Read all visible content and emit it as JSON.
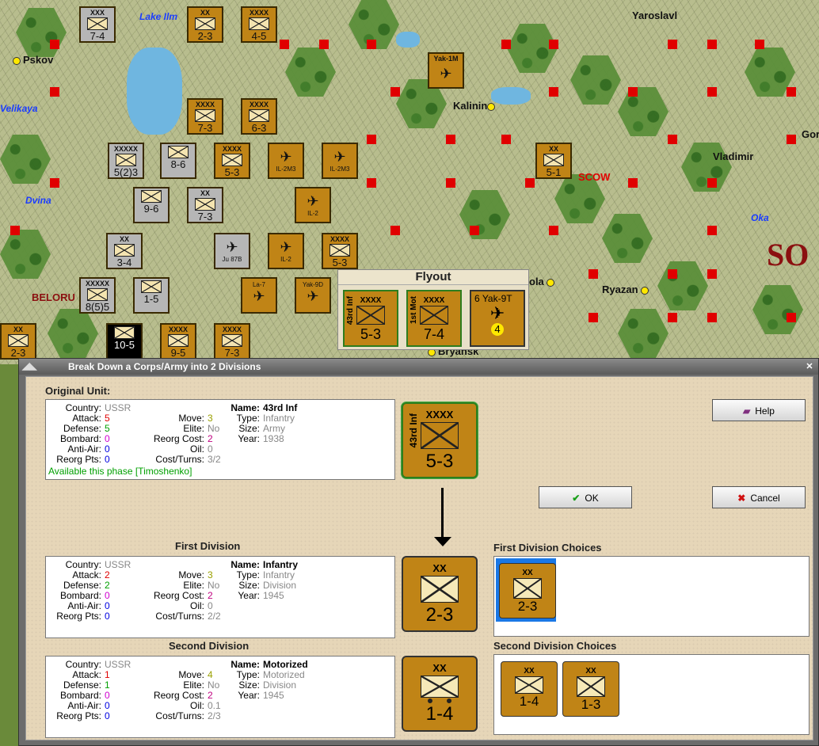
{
  "map": {
    "cities": [
      "Pskov",
      "Kalinin",
      "Yaroslavl",
      "Vladimir",
      "Ryazan",
      "Bryansk",
      "Gor",
      "SCOW",
      "ola"
    ],
    "rivers": [
      "Lake Ilm",
      "Velikaya",
      "Dvina",
      "Oka"
    ],
    "region_big": "SO",
    "region_small": "BELORU",
    "stacks": [
      {
        "size": "XXX",
        "vals": "7-4",
        "kind": "g"
      },
      {
        "size": "XX",
        "vals": "2-3",
        "kind": "o"
      },
      {
        "size": "XXXX",
        "vals": "4-5",
        "kind": "o"
      },
      {
        "size": "",
        "vals": "Yak-1M",
        "kind": "o"
      },
      {
        "size": "XXXX",
        "vals": "7-3",
        "kind": "o"
      },
      {
        "size": "XXXX",
        "vals": "6-3",
        "kind": "o"
      },
      {
        "size": "XXXXX",
        "vals": "5(2)3",
        "kind": "g"
      },
      {
        "size": "",
        "vals": "8-6",
        "kind": "g"
      },
      {
        "size": "XXXX",
        "vals": "5-3",
        "kind": "o"
      },
      {
        "size": "",
        "vals": "IL-2M3",
        "kind": "o"
      },
      {
        "size": "",
        "vals": "IL-2M3",
        "kind": "o"
      },
      {
        "size": "XX",
        "vals": "5-1",
        "kind": "o"
      },
      {
        "size": "",
        "vals": "9-6",
        "kind": "g"
      },
      {
        "size": "XX",
        "vals": "7-3",
        "kind": "g"
      },
      {
        "size": "",
        "vals": "IL-2",
        "kind": "o"
      },
      {
        "size": "XX",
        "vals": "3-4",
        "kind": "g"
      },
      {
        "size": "",
        "vals": "Ju 87B",
        "kind": "g"
      },
      {
        "size": "",
        "vals": "IL-2",
        "kind": "o"
      },
      {
        "size": "XXXX",
        "vals": "5-3",
        "kind": "o"
      },
      {
        "size": "XXXXX",
        "vals": "8(5)5",
        "kind": "g"
      },
      {
        "size": "",
        "vals": "1-5",
        "kind": "g"
      },
      {
        "size": "",
        "vals": "La-7",
        "kind": "o"
      },
      {
        "size": "",
        "vals": "Yak-9D",
        "kind": "o"
      },
      {
        "size": "XX",
        "vals": "2-3",
        "kind": "o"
      },
      {
        "size": "",
        "vals": "10-5",
        "kind": "b"
      },
      {
        "size": "XXXX",
        "vals": "9-5",
        "kind": "o"
      },
      {
        "size": "XXXX",
        "vals": "7-3",
        "kind": "o"
      }
    ]
  },
  "flyout": {
    "title": "Flyout",
    "units": [
      {
        "name": "43rd Inf",
        "size": "XXXX",
        "vals": "5-3"
      },
      {
        "name": "1st Mot",
        "size": "XXXX",
        "vals": "7-4"
      },
      {
        "name": "Yak-9T",
        "size": "6",
        "vals": "4"
      }
    ]
  },
  "dialog": {
    "title": "Break Down a Corps/Army into 2 Divisions",
    "original_label": "Original Unit:",
    "first_label": "First Division",
    "second_label": "Second Division",
    "first_choices_label": "First Division Choices",
    "second_choices_label": "Second Division Choices",
    "help_label": "Help",
    "ok_label": "OK",
    "cancel_label": "Cancel",
    "original": {
      "country": "USSR",
      "attack": "5",
      "defense": "5",
      "bombard": "0",
      "antiair": "0",
      "reorgpts": "0",
      "move": "3",
      "elite": "No",
      "reorgcost": "2",
      "oil": "0",
      "costturns": "3/2",
      "name": "43rd Inf",
      "type": "Infantry",
      "size": "Army",
      "year": "1938",
      "available": "Available this phase [Timoshenko]",
      "counter": {
        "size": "XXXX",
        "vals": "5-3",
        "name": "43rd Inf"
      }
    },
    "first": {
      "country": "USSR",
      "attack": "2",
      "defense": "2",
      "bombard": "0",
      "antiair": "0",
      "reorgpts": "0",
      "move": "3",
      "elite": "No",
      "reorgcost": "2",
      "oil": "0",
      "costturns": "2/2",
      "name": "Infantry",
      "type": "Infantry",
      "size": "Division",
      "year": "1945",
      "counter": {
        "size": "XX",
        "vals": "2-3"
      }
    },
    "second": {
      "country": "USSR",
      "attack": "1",
      "defense": "1",
      "bombard": "0",
      "antiair": "0",
      "reorgpts": "0",
      "move": "4",
      "elite": "No",
      "reorgcost": "2",
      "oil": "0.1",
      "costturns": "2/3",
      "name": "Motorized",
      "type": "Motorized",
      "size": "Division",
      "year": "1945",
      "counter": {
        "size": "XX",
        "vals": "1-4"
      }
    },
    "first_choices": [
      {
        "size": "XX",
        "vals": "2-3"
      }
    ],
    "second_choices": [
      {
        "size": "XX",
        "vals": "1-4"
      },
      {
        "size": "XX",
        "vals": "1-3"
      }
    ],
    "keys": {
      "country": "Country:",
      "attack": "Attack:",
      "defense": "Defense:",
      "bombard": "Bombard:",
      "antiair": "Anti-Air:",
      "reorgpts": "Reorg Pts:",
      "move": "Move:",
      "elite": "Elite:",
      "reorgcost": "Reorg Cost:",
      "oil": "Oil:",
      "costturns": "Cost/Turns:",
      "name": "Name:",
      "type": "Type:",
      "size": "Size:",
      "year": "Year:"
    },
    "colors": {
      "attack": "#e00000",
      "defense": "#00a000",
      "bombard": "#d000d0",
      "antiair": "#0000e0",
      "reorgpts": "#0000e0",
      "move": "#9aa000",
      "reorgcost": "#c00080"
    }
  }
}
